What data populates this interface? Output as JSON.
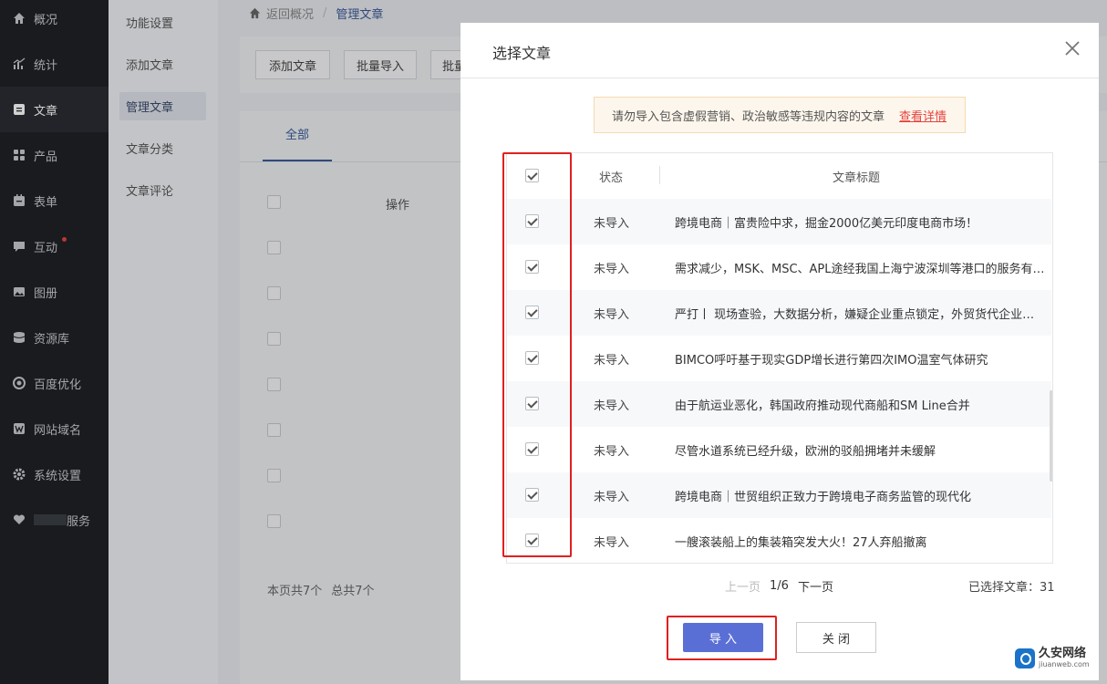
{
  "nav": {
    "items": [
      {
        "label": "概况",
        "icon": "home-icon"
      },
      {
        "label": "统计",
        "icon": "chart-icon"
      },
      {
        "label": "文章",
        "icon": "article-icon"
      },
      {
        "label": "产品",
        "icon": "grid-icon"
      },
      {
        "label": "表单",
        "icon": "form-icon"
      },
      {
        "label": "互动",
        "icon": "chat-icon"
      },
      {
        "label": "图册",
        "icon": "image-icon"
      },
      {
        "label": "资源库",
        "icon": "database-icon"
      },
      {
        "label": "百度优化",
        "icon": "target-icon"
      },
      {
        "label": "网站域名",
        "icon": "w-icon"
      },
      {
        "label": "系统设置",
        "icon": "gear-icon"
      },
      {
        "label": "服务",
        "icon": "heart-icon"
      }
    ]
  },
  "submenu": {
    "items": [
      "功能设置",
      "添加文章",
      "管理文章",
      "文章分类",
      "文章评论"
    ]
  },
  "breadcrumb": {
    "back": "返回概况",
    "sep": "/",
    "current": "管理文章"
  },
  "toolbar": {
    "add": "添加文章",
    "batch_import": "批量导入",
    "batch_partial": "批量"
  },
  "panel": {
    "tab_all": "全部",
    "op_header": "操作",
    "footer_page": "本页共7个",
    "footer_total": "总共7个"
  },
  "modal": {
    "title": "选择文章",
    "warning": "请勿导入包含虚假营销、政治敏感等违规内容的文章",
    "warning_link": "查看详情",
    "columns": {
      "status": "状态",
      "title": "文章标题"
    },
    "rows": [
      {
        "status": "未导入",
        "title": "跨境电商｜富贵险中求，掘金2000亿美元印度电商市场！"
      },
      {
        "status": "未导入",
        "title": "需求减少，MSK、MSC、APL途经我国上海宁波深圳等港口的服务有所调整"
      },
      {
        "status": "未导入",
        "title": "严打丨 现场查验，大数据分析，嫌疑企业重点锁定，外贸货代企业注意了"
      },
      {
        "status": "未导入",
        "title": "BIMCO呼吁基于现实GDP增长进行第四次IMO温室气体研究"
      },
      {
        "status": "未导入",
        "title": "由于航运业恶化，韩国政府推动现代商船和SM Line合并"
      },
      {
        "status": "未导入",
        "title": "尽管水道系统已经升级，欧洲的驳船拥堵并未缓解"
      },
      {
        "status": "未导入",
        "title": "跨境电商｜世贸组织正致力于跨境电子商务监管的现代化"
      },
      {
        "status": "未导入",
        "title": "一艘滚装船上的集装箱突发大火！27人弃船撤离"
      }
    ],
    "pager": {
      "prev": "上一页",
      "current": "1/6",
      "next": "下一页"
    },
    "selected": "已选择文章：31",
    "import_button": "导 入",
    "close_button": "关 闭"
  },
  "watermark": {
    "cn": "久安网络",
    "en": "jiuanweb.com"
  },
  "colors": {
    "nav_bg": "#1f2227",
    "accent": "#5a6fd6",
    "highlight_box": "#e02020",
    "warning_link": "#e64340"
  }
}
